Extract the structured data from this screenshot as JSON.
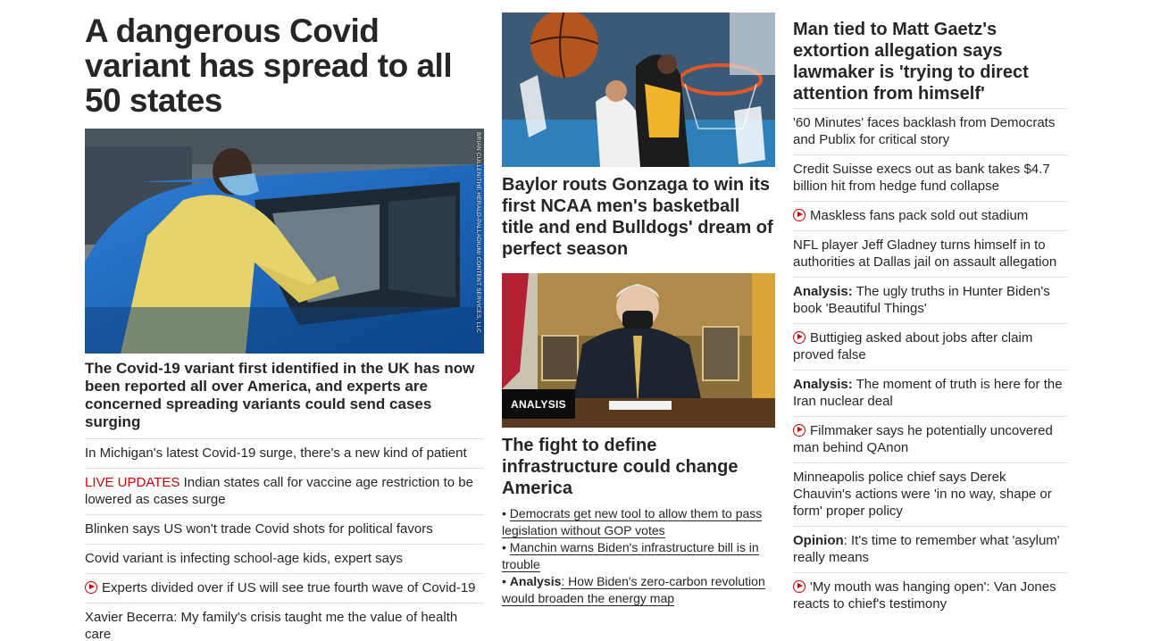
{
  "left": {
    "headline": "A dangerous Covid variant has spread to all 50 states",
    "photo_credit": "BRIAN CULLEN/THE HERALD-PALLADIUM/ CONTENT SERVICES, LLC",
    "description": "The Covid-19 variant first identified in the UK has now been reported all over America, and experts are concerned spreading variants could send cases surging",
    "items": [
      {
        "text": "In Michigan's latest Covid-19 surge, there's a new kind of patient"
      },
      {
        "live": "LIVE UPDATES",
        "text": " Indian states call for vaccine age restriction to be lowered as cases surge"
      },
      {
        "text": "Blinken says US won't trade Covid shots for political favors"
      },
      {
        "text": "Covid variant is infecting school-age kids, expert says"
      },
      {
        "text": "Experts divided over if US will see true fourth wave of Covid-19",
        "icon": "play-icon"
      },
      {
        "text": "Xavier Becerra: My family's crisis taught me the value of health care"
      }
    ]
  },
  "middle": {
    "story1_headline": "Baylor routs Gonzaga to win its first NCAA men's basketball title and end Bulldogs' dream of perfect season",
    "badge": "ANALYSIS",
    "story2_headline": "The fight to define infrastructure could change America",
    "sub_links": [
      {
        "bullet": "•",
        "kicker": "",
        "text": "Democrats get new tool to allow them to pass legislation without GOP votes"
      },
      {
        "bullet": "•",
        "kicker": "",
        "text": "Manchin warns Biden's infrastructure bill is in trouble"
      },
      {
        "bullet": "•",
        "kicker": "Analysis",
        "text": ": How Biden's zero-carbon revolution would broaden the energy map"
      }
    ]
  },
  "right": {
    "headline": "Man tied to Matt Gaetz's extortion allegation says lawmaker is 'trying to direct attention from himself'",
    "items": [
      {
        "kicker": "",
        "text": "'60 Minutes' faces backlash from Democrats and Publix for critical story"
      },
      {
        "kicker": "",
        "text": "Credit Suisse execs out as bank takes $4.7 billion hit from hedge fund collapse"
      },
      {
        "kicker": "",
        "text": "Maskless fans pack sold out stadium",
        "icon": "play-icon"
      },
      {
        "kicker": "",
        "text": "NFL player Jeff Gladney turns himself in to authorities at Dallas jail on assault allegation"
      },
      {
        "kicker": "Analysis:",
        "text": " The ugly truths in Hunter Biden's book 'Beautiful Things'"
      },
      {
        "kicker": "",
        "text": "Buttigieg asked about jobs after claim proved false",
        "icon": "play-icon"
      },
      {
        "kicker": "Analysis:",
        "text": " The moment of truth is here for the Iran nuclear deal"
      },
      {
        "kicker": "",
        "text": "Filmmaker says he potentially uncovered man behind QAnon",
        "icon": "play-icon"
      },
      {
        "kicker": "",
        "text": "Minneapolis police chief says Derek Chauvin's actions were 'in no way, shape or form' proper policy"
      },
      {
        "kicker": "Opinion",
        "text": ": It's time to remember what 'asylum' really means"
      },
      {
        "kicker": "",
        "text": "'My mouth was hanging open': Van Jones reacts to chief's testimony",
        "icon": "play-icon"
      }
    ]
  },
  "colors": {
    "text": "#262626",
    "live": "#cc0000",
    "divider": "#e1e1e1",
    "badge_bg": "#0c0c0c"
  }
}
